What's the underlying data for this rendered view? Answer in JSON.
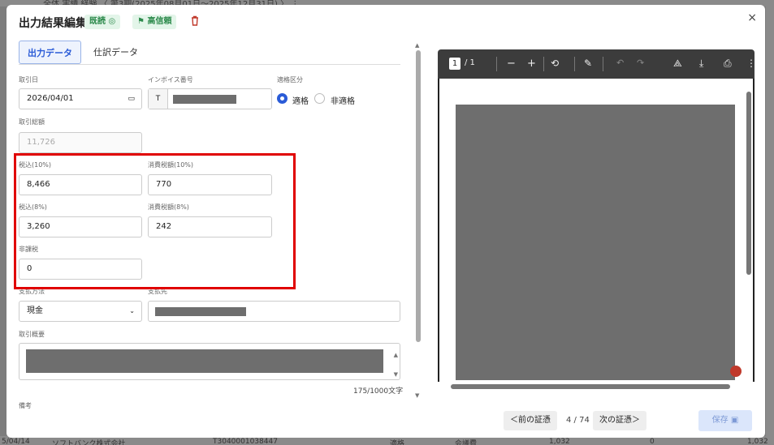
{
  "background": {
    "top_text": "…  全体  実績  経験  〈  第3期(2025年08月01日～2025年12月31日)  〉  ⋮",
    "bottom_cells": [
      "5/04/14",
      "ソフトバンク株式会社",
      "T3040001038447",
      "適格",
      "会議費",
      "1,032",
      "0",
      "1,032"
    ]
  },
  "header": {
    "title": "出力結果編集",
    "badge_read": "既読 ◎",
    "badge_trust": "高信頼",
    "close": "×"
  },
  "tabs": [
    {
      "label": "出力データ",
      "active": true
    },
    {
      "label": "仕訳データ",
      "active": false
    }
  ],
  "form": {
    "date": {
      "label": "取引日",
      "value": "2026/04/01"
    },
    "invoice": {
      "label": "インボイス番号",
      "prefix": "T"
    },
    "qualified": {
      "label": "適格区分",
      "options": [
        "適格",
        "非適格"
      ],
      "selected": "適格"
    },
    "total": {
      "label": "取引総額",
      "value": "11,726"
    },
    "tax10": {
      "label": "税込(10%)",
      "value": "8,466"
    },
    "ctax10": {
      "label": "消費税額(10%)",
      "value": "770"
    },
    "tax8": {
      "label": "税込(8%)",
      "value": "3,260"
    },
    "ctax8": {
      "label": "消費税額(8%)",
      "value": "242"
    },
    "nontax": {
      "label": "非課税",
      "value": "0"
    },
    "payment": {
      "label": "支払方法",
      "value": "現金"
    },
    "payee": {
      "label": "支払先"
    },
    "summary": {
      "label": "取引概要",
      "counter": "175/1000文字"
    },
    "memo": {
      "label": "備考"
    }
  },
  "pdf": {
    "page_current": "1",
    "page_total": "/ 1"
  },
  "footer": {
    "prev": "＜前の証憑",
    "count": "4 / 74",
    "next": "次の証憑＞",
    "save": "保存"
  },
  "colors": {
    "accent": "#2a5bd7",
    "highlight": "#e00000",
    "badge_green": "#2e8b4d"
  }
}
